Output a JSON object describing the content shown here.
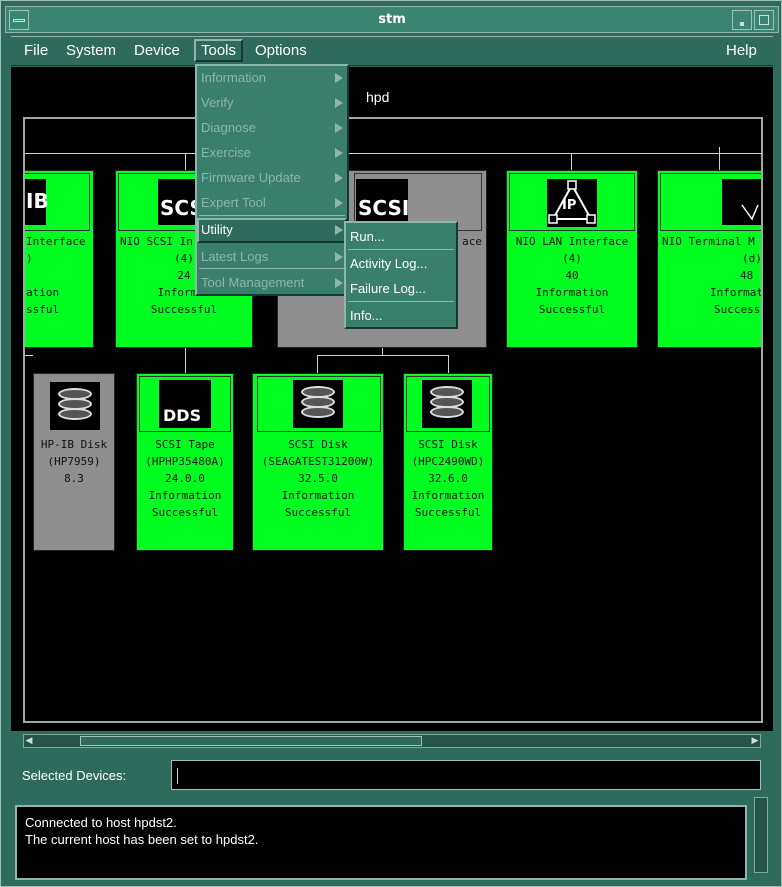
{
  "window": {
    "title": "stm"
  },
  "menubar": {
    "items": [
      "File",
      "System",
      "Device",
      "Tools",
      "Options"
    ],
    "help": "Help"
  },
  "host": {
    "name": "hpd"
  },
  "tools_menu": {
    "items": [
      {
        "label": "Information",
        "enabled": false
      },
      {
        "label": "Verify",
        "enabled": false
      },
      {
        "label": "Diagnose",
        "enabled": false
      },
      {
        "label": "Exercise",
        "enabled": false
      },
      {
        "label": "Firmware Update",
        "enabled": false
      },
      {
        "label": "Expert Tool",
        "enabled": false
      },
      {
        "label": "Utility",
        "enabled": true
      },
      {
        "label": "Latest Logs",
        "enabled": false
      },
      {
        "label": "Tool Management",
        "enabled": false
      }
    ]
  },
  "utility_menu": {
    "items": [
      "Run...",
      "Activity Log...",
      "Failure Log...",
      "Info..."
    ]
  },
  "devices_top": [
    {
      "icon_text": "IB",
      "lines": [
        "Interface",
        ")",
        "ation",
        "ssful"
      ],
      "status": "ok"
    },
    {
      "icon_text": "SCS",
      "lines": [
        "NIO SCSI In",
        "(4)",
        "24",
        "Informat",
        "Successful"
      ],
      "status": "ok"
    },
    {
      "icon_text": "SCSI",
      "lines": [
        "ace"
      ],
      "status": "unknown"
    },
    {
      "icon_text": "IP",
      "lines": [
        "NIO LAN Interface",
        "(4)",
        "40",
        "Information",
        "Successful"
      ],
      "status": "ok"
    },
    {
      "icon_text": "",
      "lines": [
        "NIO Terminal M",
        "(d)",
        "48",
        "Informat",
        "Success"
      ],
      "status": "ok"
    }
  ],
  "devices_bottom": [
    {
      "icon_text": "",
      "lines": [
        "HP-IB Disk",
        "(HP7959)",
        "8.3"
      ],
      "status": "unknown"
    },
    {
      "icon_text": "DDS",
      "lines": [
        "SCSI Tape",
        "(HPHP35480A)",
        "24.0.0",
        "Information",
        "Successful"
      ],
      "status": "ok"
    },
    {
      "icon_text": "",
      "lines": [
        "SCSI Disk",
        "(SEAGATEST31200W)",
        "32.5.0",
        "Information",
        "Successful"
      ],
      "status": "ok"
    },
    {
      "icon_text": "",
      "lines": [
        "SCSI Disk",
        "(HPC2490WD)",
        "32.6.0",
        "Information",
        "Successful"
      ],
      "status": "ok"
    }
  ],
  "selected": {
    "label": "Selected Devices:",
    "value": ""
  },
  "status": {
    "lines": [
      "Connected to host hpdst2.",
      "The current host has been set to hpdst2."
    ]
  },
  "colors": {
    "ok": "#00ff20",
    "unknown": "#8e8e8e",
    "chrome": "#2e6b5c"
  }
}
